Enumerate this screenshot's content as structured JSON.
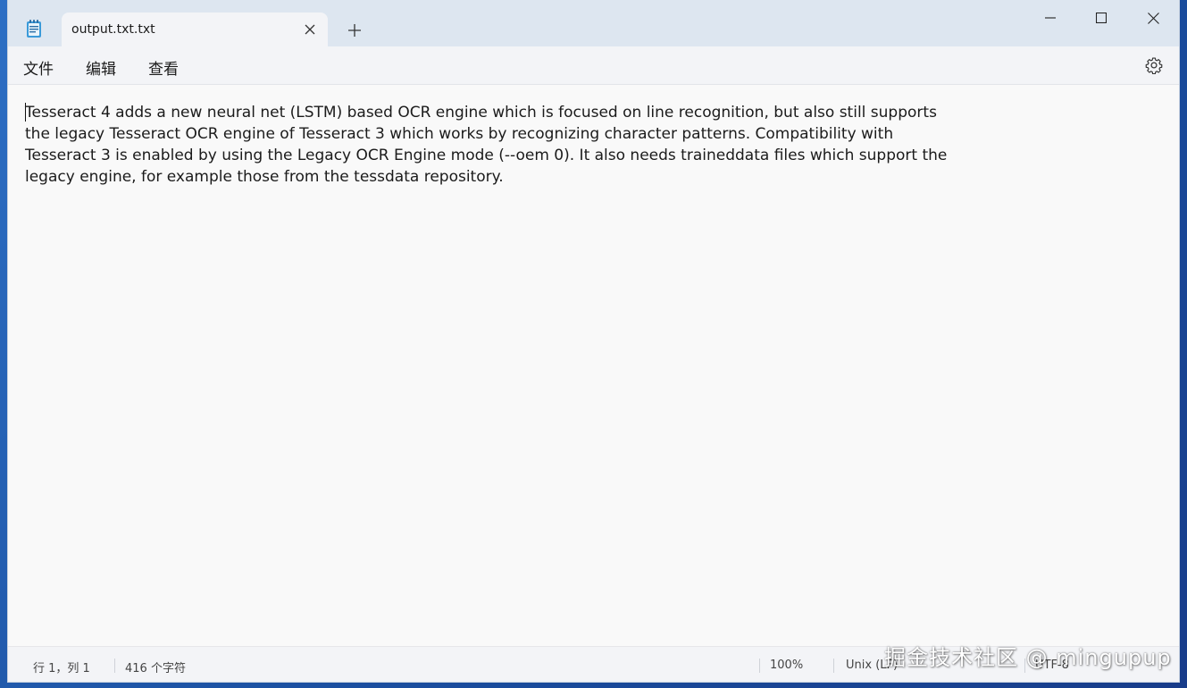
{
  "window": {
    "tab_title": "output.txt.txt",
    "app_icon": "notepad-icon",
    "tab_close_icon": "close-icon",
    "new_tab_icon": "plus-icon",
    "minimize_icon": "minimize-icon",
    "maximize_icon": "maximize-icon",
    "close_icon": "close-icon"
  },
  "menu": {
    "file": "文件",
    "edit": "编辑",
    "view": "查看",
    "settings_icon": "gear-icon"
  },
  "editor": {
    "content": "Tesseract 4 adds a new neural net (LSTM) based OCR engine which is focused on line recognition, but also still supports the legacy Tesseract OCR engine of Tesseract 3 which works by recognizing character patterns. Compatibility with Tesseract 3 is enabled by using the Legacy OCR Engine mode (--oem 0). It also needs traineddata files which support the legacy engine, for example those from the tessdata repository."
  },
  "status": {
    "position": "行 1，列 1",
    "char_count": "416 个字符",
    "zoom": "100%",
    "line_ending": "Unix (LF)",
    "encoding": "UTF-8"
  },
  "watermark": "掘金技术社区 @ mingupup",
  "colors": {
    "titlebar": "#dde6f0",
    "tab": "#f3f4f7",
    "editor_bg": "#f9f9f9",
    "desktop_accent": "#1b4fa0"
  }
}
